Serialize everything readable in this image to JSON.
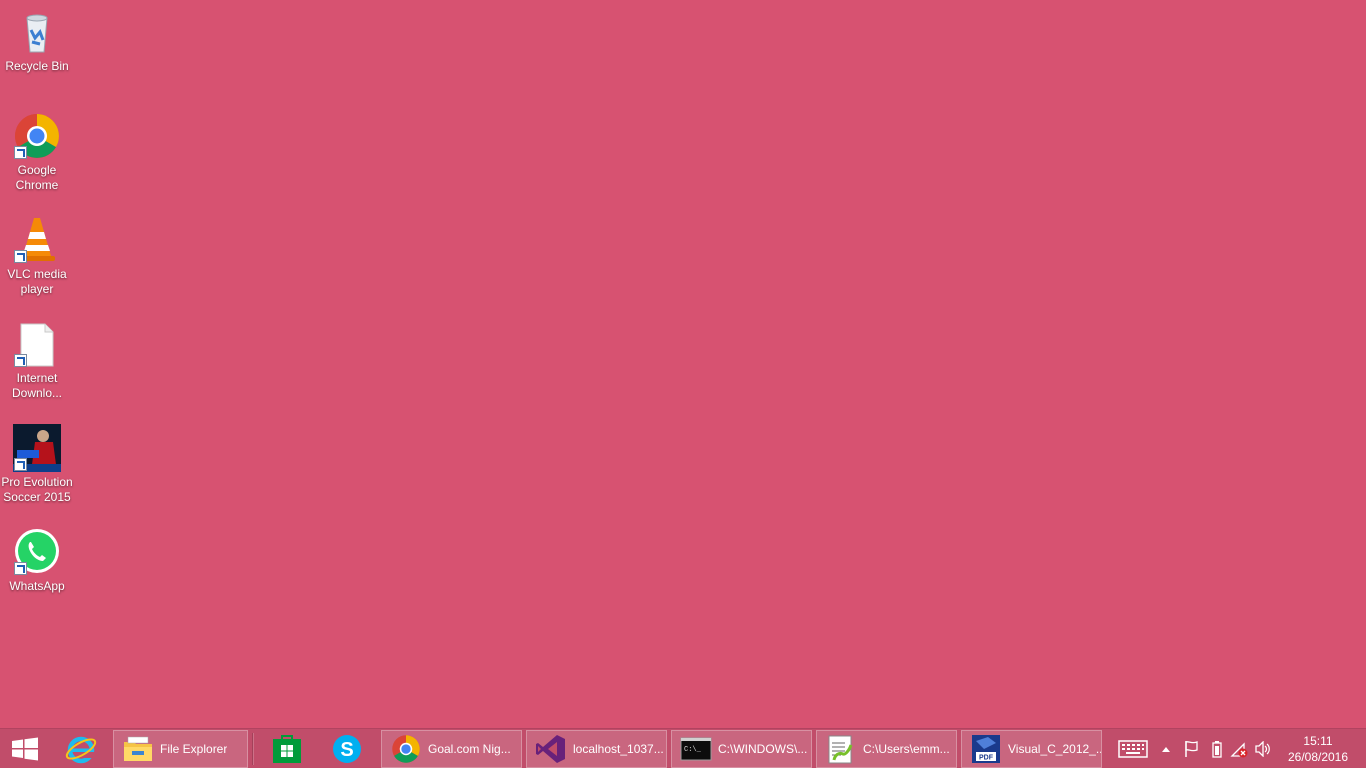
{
  "desktop": {
    "background_color": "#d75271",
    "icons": [
      {
        "label": "Recycle Bin",
        "icon": "recycle-bin-icon"
      },
      {
        "label": "Google Chrome",
        "icon": "chrome-icon"
      },
      {
        "label": "VLC media player",
        "icon": "vlc-icon"
      },
      {
        "label": "Internet Downlo...",
        "icon": "document-icon"
      },
      {
        "label": "Pro Evolution Soccer 2015",
        "icon": "pes-icon"
      },
      {
        "label": "WhatsApp",
        "icon": "whatsapp-icon"
      }
    ]
  },
  "taskbar": {
    "color": "#c14d6a",
    "pinned": [
      {
        "icon": "start-icon"
      },
      {
        "icon": "internet-explorer-icon"
      }
    ],
    "buttons": [
      {
        "label": "File Explorer",
        "icon": "file-explorer-icon"
      },
      {
        "label": "",
        "icon": "store-icon"
      },
      {
        "label": "",
        "icon": "skype-icon"
      },
      {
        "label": "Goal.com Nig...",
        "icon": "chrome-icon"
      },
      {
        "label": "localhost_1037...",
        "icon": "visual-studio-icon"
      },
      {
        "label": "C:\\WINDOWS\\...",
        "icon": "command-prompt-icon"
      },
      {
        "label": "C:\\Users\\emm...",
        "icon": "notepad-plus-icon"
      },
      {
        "label": "Visual_C_2012_...",
        "icon": "pdf-icon"
      }
    ],
    "tray": {
      "icons": [
        "keyboard-icon",
        "chevron-up-icon",
        "flag-icon",
        "battery-icon",
        "network-icon",
        "volume-icon"
      ],
      "time": "15:11",
      "date": "26/08/2016"
    }
  }
}
